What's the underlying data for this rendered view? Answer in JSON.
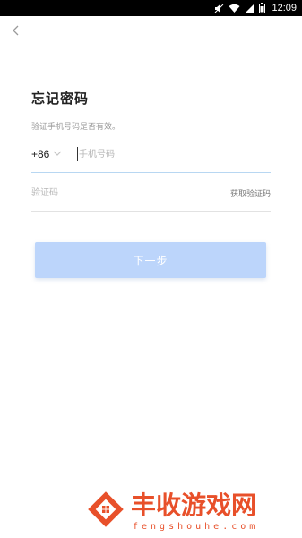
{
  "status_bar": {
    "time": "12:09"
  },
  "header": {
    "back_icon": "chevron-left-icon"
  },
  "main": {
    "title": "忘记密码",
    "subtitle": "验证手机号码是否有效。",
    "phone": {
      "country_code": "+86",
      "placeholder": "手机号码",
      "value": ""
    },
    "code": {
      "placeholder": "验证码",
      "value": "",
      "get_code_label": "获取验证码"
    },
    "next_button_label": "下一步"
  },
  "watermark": {
    "title": "丰收游戏网",
    "subtitle": "fengshouhe.com"
  },
  "colors": {
    "button_bg": "#bcd5fb",
    "active_underline": "#b8d7f2",
    "watermark": "#e8502a"
  }
}
